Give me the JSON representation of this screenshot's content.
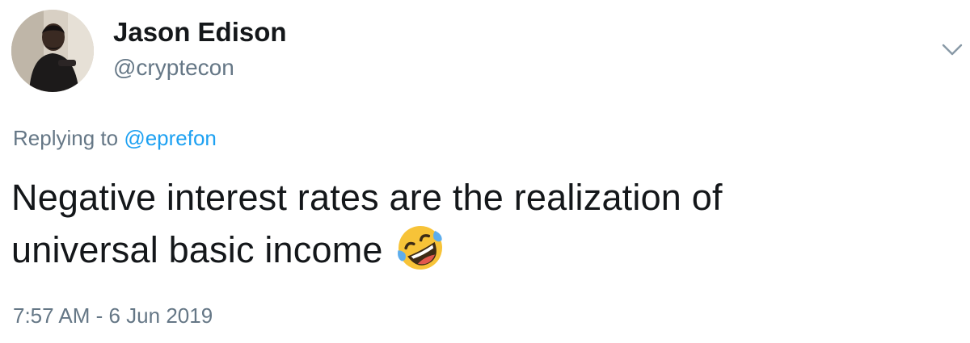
{
  "author": {
    "display_name": "Jason Edison",
    "handle": "@cryptecon"
  },
  "reply": {
    "prefix": "Replying to",
    "mention": "@eprefon"
  },
  "tweet": {
    "line1": "Negative interest rates are the realization of",
    "line2": "universal basic income",
    "emoji": "rolling-on-the-floor-laughing-icon"
  },
  "meta": {
    "timestamp": "7:57 AM - 6 Jun 2019"
  },
  "colors": {
    "text": "#14171a",
    "secondary": "#657786",
    "link": "#1da1f2"
  },
  "icons": {
    "menu": "chevron-down-icon"
  }
}
